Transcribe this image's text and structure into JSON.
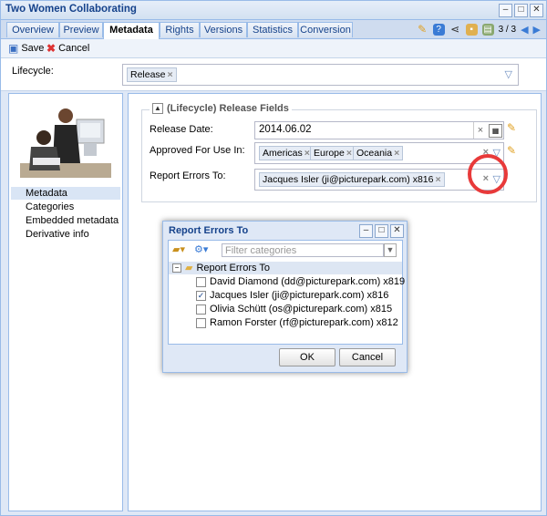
{
  "window": {
    "title": "Two Women Collaborating",
    "page_counter": "3 / 3"
  },
  "tabs": [
    "Overview",
    "Preview",
    "Metadata",
    "Rights",
    "Versions",
    "Statistics",
    "Conversion"
  ],
  "toolbar": {
    "save_label": "Save",
    "cancel_label": "Cancel"
  },
  "lifecycle": {
    "label": "Lifecycle:",
    "value": "Release"
  },
  "nav": {
    "items": [
      "Metadata",
      "Categories",
      "Embedded metadata",
      "Derivative info"
    ],
    "selected": "Metadata"
  },
  "fields": {
    "section_title": "(Lifecycle) Release Fields",
    "release_date_label": "Release Date:",
    "release_date_value": "2014.06.02",
    "approved_label": "Approved For Use In:",
    "approved_values": [
      "Americas",
      "Europe",
      "Oceania"
    ],
    "report_label": "Report Errors To:",
    "report_value": "Jacques Isler (ji@picturepark.com) x816"
  },
  "dialog": {
    "title": "Report Errors To",
    "filter_placeholder": "Filter categories",
    "root_label": "Report Errors To",
    "items": [
      {
        "label": "David Diamond (dd@picturepark.com) x819",
        "checked": false
      },
      {
        "label": "Jacques Isler (ji@picturepark.com) x816",
        "checked": true
      },
      {
        "label": "Olivia Schütt (os@picturepark.com) x815",
        "checked": false
      },
      {
        "label": "Ramon Forster (rf@picturepark.com) x812",
        "checked": false
      }
    ],
    "ok_label": "OK",
    "cancel_label": "Cancel"
  },
  "colors": {
    "highlight": "#e83a3a",
    "accent": "#15428b"
  }
}
